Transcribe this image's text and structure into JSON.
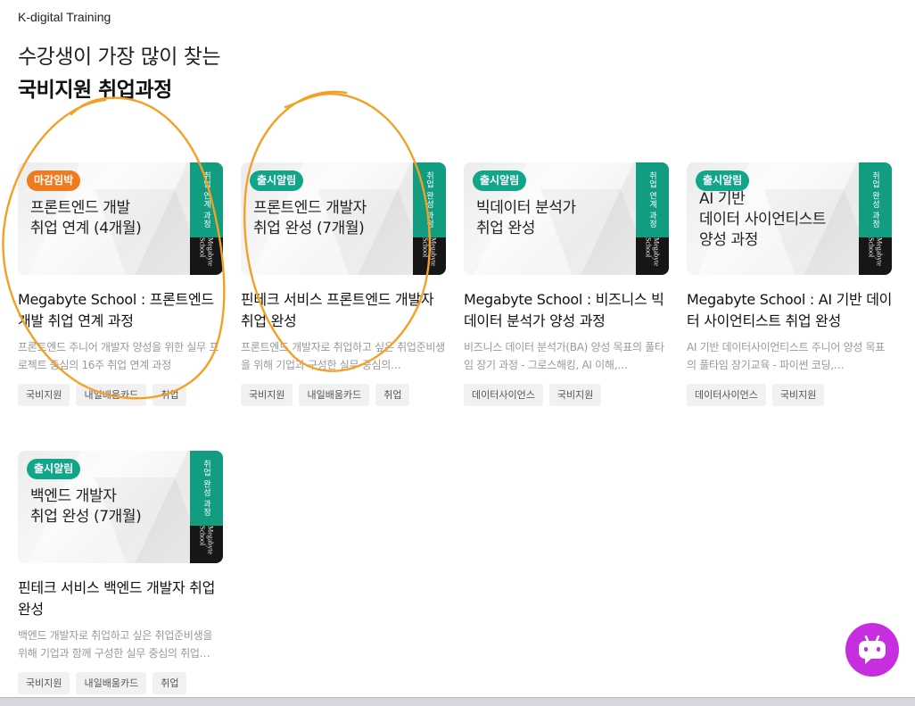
{
  "header": {
    "brand": "K-digital Training",
    "headline": "수강생이 가장 많이 찾는",
    "headline_strong": "국비지원 취업과정"
  },
  "courses": [
    {
      "badge": "마감임박",
      "badge_color": "#f07b1e",
      "thumb_title": "프론트엔드 개발\n취업 연계 (4개월)",
      "side_label": "취업 연계 과정",
      "school_logo": "Megabyte School",
      "title": "Megabyte School : 프론트엔드 개발 취업 연계 과정",
      "desc": "프론트엔드 주니어 개발자 양성을 위한 실무 프로젝트 중심의 16주 취업 연계 과정",
      "tags": [
        "국비지원",
        "내일배움카드",
        "취업"
      ]
    },
    {
      "badge": "출시알림",
      "badge_color": "#11a589",
      "thumb_title": "프론트엔드 개발자\n취업 완성 (7개월)",
      "side_label": "취업 완성 과정",
      "school_logo": "Megabyte School",
      "title": "핀테크 서비스 프론트엔드 개발자 취업 완성",
      "desc": "프론트엔드 개발자로 취업하고 싶은 취업준비생을 위해 기업과 구성한 실무 중심의…",
      "tags": [
        "국비지원",
        "내일배움카드",
        "취업"
      ]
    },
    {
      "badge": "출시알림",
      "badge_color": "#11a589",
      "thumb_title": "빅데이터 분석가\n취업 완성",
      "side_label": "취업 연계 과정",
      "school_logo": "Megabyte School",
      "title": "Megabyte School : 비즈니스 빅데이터 분석가 양성 과정",
      "desc": "비즈니스 데이터 분석가(BA) 양성 목표의 풀타임 장기 과정 - 그로스해킹, AI 이해,…",
      "tags": [
        "데이터사이언스",
        "국비지원"
      ]
    },
    {
      "badge": "출시알림",
      "badge_color": "#11a589",
      "thumb_title": "AI 기반\n데이터 사이언티스트\n양성 과정",
      "side_label": "취업 완성 과정",
      "school_logo": "Megabyte School",
      "title": "Megabyte School : AI 기반 데이터 사이언티스트 취업 완성",
      "desc": "AI 기반 데이터사이언티스트 주니어 양성 목표의 풀타임 장기교육 - 파이썬 코딩,…",
      "tags": [
        "데이터사이언스",
        "국비지원"
      ]
    },
    {
      "badge": "출시알림",
      "badge_color": "#11a589",
      "thumb_title": "백엔드 개발자\n취업 완성 (7개월)",
      "side_label": "취업 완성 과정",
      "school_logo": "Megabyte School",
      "title": "핀테크 서비스 백엔드 개발자 취업 완성",
      "desc": "백엔드 개발자로 취업하고 싶은 취업준비생을 위해 기업과 함께 구성한 실무 중심의 취업…",
      "tags": [
        "국비지원",
        "내일배움카드",
        "취업"
      ]
    }
  ],
  "colors": {
    "teal": "#129c80",
    "orange_badge": "#f07b1e",
    "annotation": "#f4a024",
    "chatbot": "#c62ee0"
  },
  "chatbot": {
    "icon": "robot-chat-icon"
  }
}
